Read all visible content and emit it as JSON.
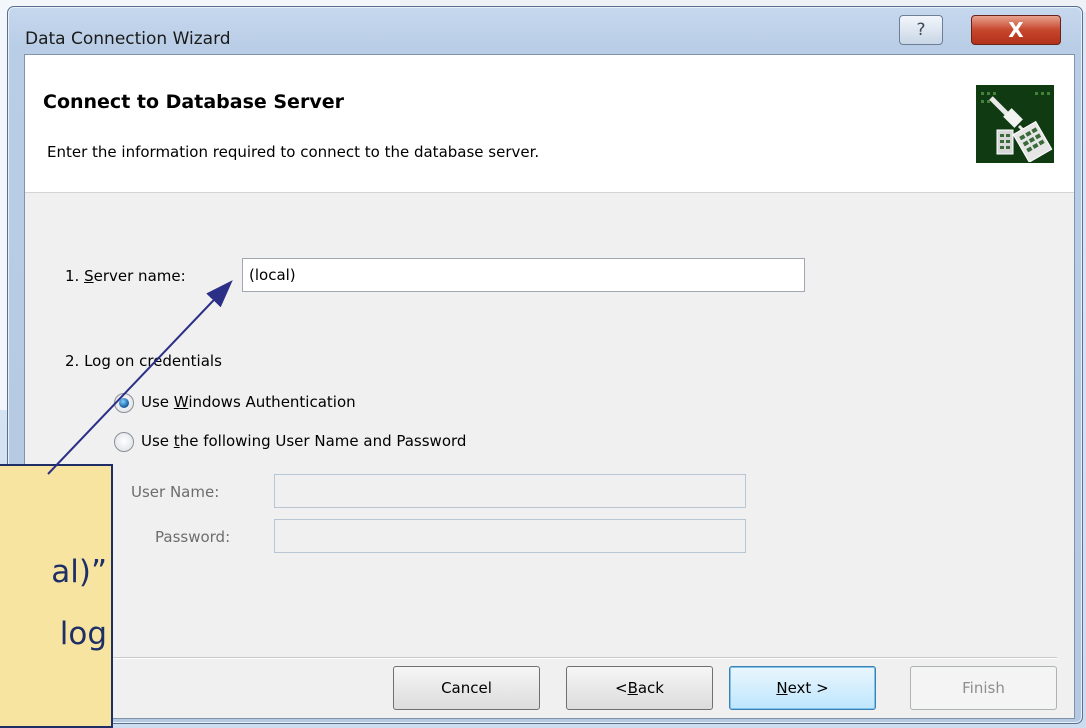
{
  "window": {
    "title": "Data Connection Wizard",
    "help_glyph": "?",
    "close_glyph": "X"
  },
  "header": {
    "title": "Connect to Database Server",
    "subtitle": "Enter the information required to connect to the database server.",
    "icon": "database-plug-icon"
  },
  "form": {
    "server_label_prefix": "1. ",
    "server_label_accel": "S",
    "server_label_rest": "erver name:",
    "server_value": "(local)",
    "credentials_label": "2. Log on credentials",
    "radio_windows_prefix": "Use ",
    "radio_windows_accel": "W",
    "radio_windows_rest": "indows Authentication",
    "radio_windows_checked": true,
    "radio_userpass_prefix": "Use ",
    "radio_userpass_accel": "t",
    "radio_userpass_rest": "he following User Name and Password",
    "username_label": "User Name:",
    "username_value": "",
    "password_label": "Password:",
    "password_value": ""
  },
  "buttons": {
    "cancel": "Cancel",
    "back_prefix": "< ",
    "back_accel": "B",
    "back_rest": "ack",
    "next_accel": "N",
    "next_rest": "ext >",
    "finish": "Finish"
  },
  "callout": {
    "line1": "al)”",
    "line2": "log"
  },
  "colors": {
    "callout_bg": "#f7e4a0",
    "callout_text": "#1d2f66",
    "close_button": "#c7462c"
  }
}
